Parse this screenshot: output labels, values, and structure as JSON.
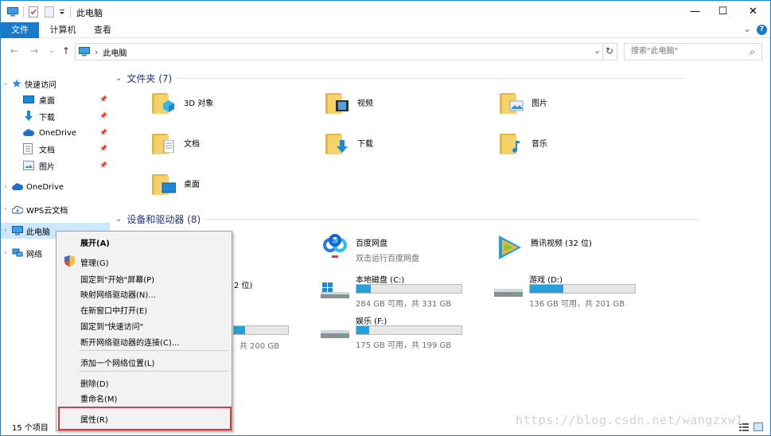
{
  "titlebar": {
    "title": "此电脑",
    "minimize": "—",
    "maximize": "☐",
    "close": "✕"
  },
  "ribbon": {
    "tabs": [
      "文件",
      "计算机",
      "查看"
    ],
    "active_tab": "文件",
    "collapse_glyph": "⌄",
    "help_glyph": "?"
  },
  "nav": {
    "back": "←",
    "forward": "→",
    "history": "⌄",
    "up": "↑",
    "breadcrumb": "此电脑",
    "sep": "›",
    "dropdown": "⌄",
    "refresh": "↻",
    "search_placeholder": "搜索\"此电脑\"",
    "search_icon": "⌕"
  },
  "sidebar": {
    "quick_access": "快速访问",
    "quick_items": [
      "桌面",
      "下载",
      "OneDrive",
      "文档",
      "图片"
    ],
    "onedrive": "OneDrive",
    "wps": "WPS云文档",
    "this_pc": "此电脑",
    "network": "网络"
  },
  "content": {
    "folders_header": "文件夹 (7)",
    "folders": [
      "3D 对象",
      "视频",
      "图片",
      "文档",
      "下载",
      "音乐",
      "桌面"
    ],
    "devices_header": "设备和驱动器 (8)",
    "apps": [
      {
        "name": "百度网盘",
        "sub": "双击运行百度网盘"
      },
      {
        "name": "腾讯视频 (32 位)",
        "sub": ""
      }
    ],
    "drives": [
      {
        "name": "本地磁盘 (C:)",
        "free": "284 GB 可用，共 331 GB",
        "used_fraction": 0.14
      },
      {
        "name": "游戏 (D:)",
        "free": "136 GB 可用，共 201 GB",
        "used_fraction": 0.32
      },
      {
        "name": "娱乐 (F:)",
        "free": "175 GB 可用，共 199 GB",
        "used_fraction": 0.12
      }
    ],
    "partial_tile_text": "2 位)",
    "partial_free_text": "共 200 GB",
    "partial_used_fraction": 0.2
  },
  "status": {
    "items": "15 个项目"
  },
  "context_menu": {
    "items": [
      "展开(A)",
      "管理(G)",
      "固定到\"开始\"屏幕(P)",
      "映射网络驱动器(N)...",
      "在新窗口中打开(E)",
      "固定到\"快速访问\"",
      "断开网络驱动器的连接(C)...",
      "添加一个网络位置(L)",
      "删除(D)",
      "重命名(M)",
      "属性(R)"
    ]
  },
  "watermark": "https://blog.csdn.net/wangzxw1",
  "colors": {
    "accent": "#1979ca",
    "selection": "#cce8ff",
    "drive_fill": "#26a0da",
    "highlight_box": "#e0393e"
  }
}
